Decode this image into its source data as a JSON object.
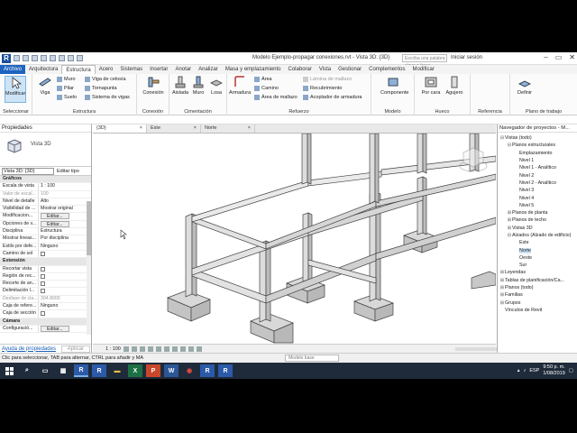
{
  "window": {
    "title": "Modelo Ejemplo-propagar conexiones.rvt - Vista 3D: {3D}",
    "search_placeholder": "Escriba una palabra clave o frase",
    "signin": "Iniciar sesión"
  },
  "ribbon_tabs": [
    "Archivo",
    "Arquitectura",
    "Estructura",
    "Acero",
    "Sistemas",
    "Insertar",
    "Anotar",
    "Analizar",
    "Masa y emplazamiento",
    "Colaborar",
    "Vista",
    "Gestionar",
    "Complementos",
    "Modificar"
  ],
  "ribbon": {
    "modify": "Modificar",
    "select_label": "Seleccionar",
    "viga": "Viga",
    "muro": "Muro",
    "pilar": "Pilar",
    "suelo": "Suelo",
    "viga_celosia": "Viga de celosía",
    "tornapunta": "Tornapunta",
    "sistema_vigas": "Sistema de vigas",
    "estructura_label": "Estructura",
    "conexion": "Conexión",
    "conexion_label": "Conexión",
    "aislada": "Aislada",
    "muro_cim": "Muro",
    "losa": "Losa",
    "cimentacion_label": "Cimentación",
    "armadura": "Armadura",
    "area": "Área",
    "camino": "Camino",
    "area_malla": "Área de mallazo",
    "lamina_malla": "Lámina de mallazo",
    "recubrimiento": "Recubrimiento",
    "acoplador": "Acoplador de armadura",
    "refuerzo_label": "Refuerzo",
    "componente": "Componente",
    "modelo_label": "Modelo",
    "por_cara": "Por cara",
    "agujero": "Agujero",
    "hueco_label": "Hueco",
    "referencia_label": "Referencia",
    "definir": "Definir",
    "plano_label": "Plano de trabajo"
  },
  "properties": {
    "title": "Propiedades",
    "type_name": "Vista 3D",
    "selector": "Vista 3D: {3D}",
    "edit_type": "Editar tipo",
    "rows": [
      {
        "k": "Gráficos",
        "group": true
      },
      {
        "k": "Escala de vista",
        "v": "1 : 100"
      },
      {
        "k": "Valor de escal...",
        "v": "100",
        "dim": true
      },
      {
        "k": "Nivel de detalle",
        "v": "Alto"
      },
      {
        "k": "Visibilidad de ...",
        "v": "Mostrar original"
      },
      {
        "k": "Modificacion...",
        "btn": "Editar..."
      },
      {
        "k": "Opciones de v...",
        "btn": "Editar..."
      },
      {
        "k": "Disciplina",
        "v": "Estructura"
      },
      {
        "k": "Mostrar lineas...",
        "v": "Por disciplina"
      },
      {
        "k": "Estilo por defe...",
        "v": "Ninguno"
      },
      {
        "k": "Camino de sol",
        "cb": true
      },
      {
        "k": "Extensión",
        "group": true
      },
      {
        "k": "Recortar vista",
        "cb": true
      },
      {
        "k": "Región de rec...",
        "cb": true
      },
      {
        "k": "Recorte de an...",
        "cb": true
      },
      {
        "k": "Delimitación l...",
        "cb": true
      },
      {
        "k": "Desfase de cla...",
        "v": "304.8000",
        "dim": true
      },
      {
        "k": "Caja de refere...",
        "v": "Ninguno"
      },
      {
        "k": "Caja de sección",
        "cb": true
      },
      {
        "k": "Cámara",
        "group": true
      },
      {
        "k": "Configuració...",
        "btn": "Editar..."
      }
    ],
    "help": "Ayuda de propiedades",
    "apply": "Aplicar"
  },
  "view_tabs": [
    "{3D}",
    "Este",
    "Norte"
  ],
  "view_scale": "1 : 100",
  "browser": {
    "title": "Navegador de proyectos - M...",
    "items": [
      {
        "t": "Vistas (todo)",
        "lvl": 0,
        "tg": "⊟"
      },
      {
        "t": "Planos estructurales",
        "lvl": 1,
        "tg": "⊟"
      },
      {
        "t": "Emplazamiento",
        "lvl": 2
      },
      {
        "t": "Nivel 1",
        "lvl": 2
      },
      {
        "t": "Nivel 1 - Analítico",
        "lvl": 2
      },
      {
        "t": "Nivel 2",
        "lvl": 2
      },
      {
        "t": "Nivel 2 - Analítico",
        "lvl": 2
      },
      {
        "t": "Nivel 3",
        "lvl": 2
      },
      {
        "t": "Nivel 4",
        "lvl": 2
      },
      {
        "t": "Nivel 5",
        "lvl": 2
      },
      {
        "t": "Planos de planta",
        "lvl": 1,
        "tg": "⊞"
      },
      {
        "t": "Planos de techo",
        "lvl": 1,
        "tg": "⊞"
      },
      {
        "t": "Vistas 3D",
        "lvl": 1,
        "tg": "⊞"
      },
      {
        "t": "Alzados (Alzado de edificio)",
        "lvl": 1,
        "tg": "⊟"
      },
      {
        "t": "Este",
        "lvl": 2
      },
      {
        "t": "Norte",
        "lvl": 2,
        "sel": true
      },
      {
        "t": "Oeste",
        "lvl": 2
      },
      {
        "t": "Sur",
        "lvl": 2
      },
      {
        "t": "Leyendas",
        "lvl": 0,
        "tg": "⊞"
      },
      {
        "t": "Tablas de planificación/Ca...",
        "lvl": 0,
        "tg": "⊞"
      },
      {
        "t": "Planos (todo)",
        "lvl": 0,
        "tg": "⊞"
      },
      {
        "t": "Familias",
        "lvl": 0,
        "tg": "⊞"
      },
      {
        "t": "Grupos",
        "lvl": 0,
        "tg": "⊞"
      },
      {
        "t": "Vínculos de Revit",
        "lvl": 0
      }
    ]
  },
  "status": {
    "hint": "Clic para seleccionar, TAB para alternar, CTRL para añadir y MA",
    "model": "Modelo base"
  },
  "taskbar": {
    "lang": "ESP",
    "time": "9:50 p. m.",
    "date": "1/08/2019",
    "icons": [
      "windows-start",
      "search",
      "task-view",
      "calculator",
      "revit",
      "revit",
      "file-explorer",
      "excel",
      "powerpoint",
      "word",
      "chrome",
      "revit",
      "revit"
    ]
  }
}
